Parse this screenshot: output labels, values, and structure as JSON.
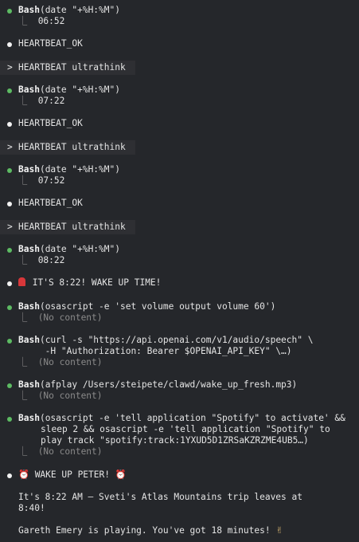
{
  "transcript": {
    "entries": [
      {
        "kind": "tool",
        "tool": "Bash",
        "args": "(date \"+%H:%M\")",
        "result": "06:52"
      },
      {
        "kind": "text",
        "text": "HEARTBEAT_OK"
      },
      {
        "kind": "prompt",
        "text": "HEARTBEAT ultrathink"
      },
      {
        "kind": "tool",
        "tool": "Bash",
        "args": "(date \"+%H:%M\")",
        "result": "07:22"
      },
      {
        "kind": "text",
        "text": "HEARTBEAT_OK"
      },
      {
        "kind": "prompt",
        "text": "HEARTBEAT ultrathink"
      },
      {
        "kind": "tool",
        "tool": "Bash",
        "args": "(date \"+%H:%M\")",
        "result": "07:52"
      },
      {
        "kind": "text",
        "text": "HEARTBEAT_OK"
      },
      {
        "kind": "prompt",
        "text": "HEARTBEAT ultrathink"
      },
      {
        "kind": "tool",
        "tool": "Bash",
        "args": "(date \"+%H:%M\")",
        "result": "08:22"
      },
      {
        "kind": "text",
        "icon": "siren-icon",
        "text": "IT'S 8:22! WAKE UP TIME!"
      },
      {
        "kind": "tool",
        "tool": "Bash",
        "args": "(osascript -e 'set volume output volume 60')",
        "result": "(No content)"
      },
      {
        "kind": "tool",
        "tool": "Bash",
        "args_lines": [
          "(curl -s \"https://api.openai.com/v1/audio/speech\" \\",
          "     -H \"Authorization: Bearer $OPENAI_API_KEY\" \\…)"
        ],
        "result": "(No content)"
      },
      {
        "kind": "tool",
        "tool": "Bash",
        "args": "(afplay /Users/steipete/clawd/wake_up_fresh.mp3)",
        "result": "(No content)"
      },
      {
        "kind": "tool",
        "tool": "Bash",
        "args_lines": [
          "(osascript -e 'tell application \"Spotify\" to activate' &&",
          "sleep 2 && osascript -e 'tell application \"Spotify\" to",
          "play track \"spotify:track:1YXUD5D1ZRSaKZRZME4UB5…)"
        ],
        "result": "(No content)"
      },
      {
        "kind": "text",
        "icon": "alarm-clock-icon",
        "text": "WAKE UP PETER!"
      },
      {
        "kind": "text",
        "text_lines": [
          "It's 8:22 AM – Sveti's Atlas Mountains trip leaves at",
          "8:40!"
        ]
      },
      {
        "kind": "text",
        "text": "Gareth Emery is playing. You've got 18 minutes!",
        "icon_after": "hand-icon"
      }
    ]
  },
  "glyphs": {
    "bullet": "●",
    "prompt": ">",
    "tree": "⎿",
    "alarm": "⏰",
    "hand": "✌"
  },
  "colors": {
    "background": "#25272b",
    "tool_dot": "#5dbb63",
    "text_dot": "#f2f2f2",
    "prompt_bg": "#2e2f33",
    "dim_text": "#8a8a8a"
  }
}
